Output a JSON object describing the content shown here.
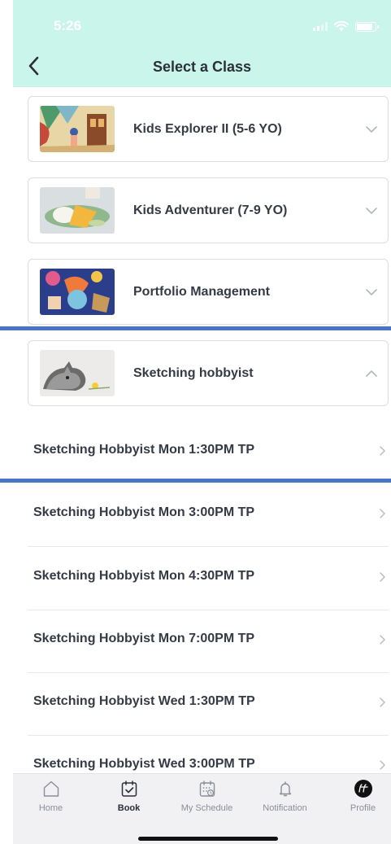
{
  "status_bar": {
    "time": "5:26"
  },
  "header": {
    "title": "Select a Class"
  },
  "classes": [
    {
      "label": "Kids Explorer II (5-6 YO)",
      "expanded": false
    },
    {
      "label": "Kids Adventurer (7-9 YO)",
      "expanded": false
    },
    {
      "label": "Portfolio Management",
      "expanded": false
    },
    {
      "label": "Sketching hobbyist",
      "expanded": true
    }
  ],
  "sessions": [
    {
      "label": "Sketching Hobbyist Mon 1:30PM TP"
    },
    {
      "label": "Sketching Hobbyist Mon 3:00PM TP"
    },
    {
      "label": "Sketching Hobbyist Mon 4:30PM TP"
    },
    {
      "label": "Sketching Hobbyist Mon 7:00PM TP"
    },
    {
      "label": "Sketching Hobbyist Wed 1:30PM TP"
    },
    {
      "label": "Sketching Hobbyist Wed 3:00PM TP"
    }
  ],
  "tabbar": {
    "items": [
      {
        "label": "Home",
        "icon": "home-icon",
        "active": false
      },
      {
        "label": "Book",
        "icon": "book-calendar-icon",
        "active": true
      },
      {
        "label": "My Schedule",
        "icon": "schedule-calendar-icon",
        "active": false
      },
      {
        "label": "Notification",
        "icon": "bell-icon",
        "active": false
      },
      {
        "label": "Profile",
        "icon": "profile-avatar-icon",
        "active": false
      }
    ]
  },
  "colors": {
    "header_bg": "#c9f5ea",
    "highlight_line": "#4a75c4",
    "tabbar_bg": "#f1f1f3",
    "text_primary": "#353a45"
  }
}
